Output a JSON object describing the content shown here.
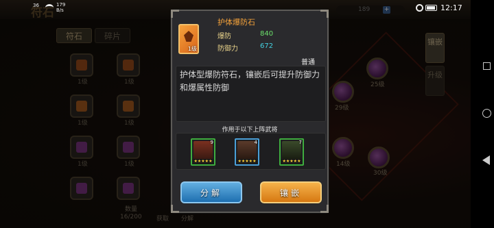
{
  "status": {
    "network": "36",
    "speed_value": "179",
    "speed_unit": "B/s",
    "time": "12:17"
  },
  "background": {
    "title": "符石",
    "resource_value": "189",
    "resource_plus": "+",
    "tabs": [
      "符石",
      "碎片"
    ],
    "slot_levels": [
      "1级",
      "1级",
      "1级",
      "1级",
      "1级",
      "1级"
    ],
    "gem_levels": [
      "25级",
      "29级",
      "14级",
      "30级"
    ],
    "side_buttons": [
      "镶嵌",
      "升级"
    ],
    "bottom": {
      "count_label": "数量",
      "count_value": "16/200",
      "get_label": "获取",
      "decompose_label": "分解"
    }
  },
  "popup": {
    "item_name": "护体爆防石",
    "item_level": "1级",
    "stats": [
      {
        "label": "爆防",
        "value": "840"
      },
      {
        "label": "防御力",
        "value": "672"
      }
    ],
    "quality": "普通",
    "description": "护体型爆防符石，镶嵌后可提升防御力和爆属性防御",
    "used_title": "作用于以下上阵武将",
    "heroes": [
      {
        "level": "9",
        "stars": "★★★★★",
        "color": "#3fae3f"
      },
      {
        "level": "4",
        "stars": "★★★★★",
        "color": "#4aa0d8"
      },
      {
        "level": "7",
        "stars": "★★★★★",
        "color": "#3fae3f"
      }
    ],
    "decompose_label": "分解",
    "embed_label": "镶嵌"
  },
  "colors": {
    "item_name": "#f4a23a",
    "stat_label": "#e8d28a",
    "stat_green": "#6be06b",
    "stat_cyan": "#43d0e0",
    "btn_blue": "#1e6fb0",
    "btn_orange": "#d67812"
  }
}
